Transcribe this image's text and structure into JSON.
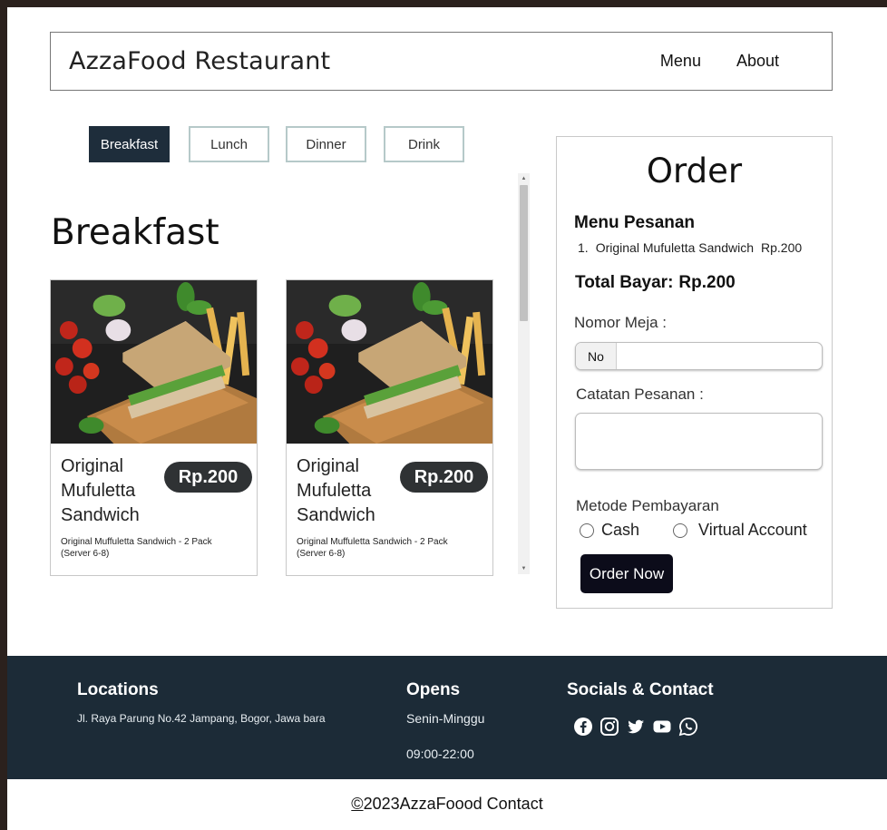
{
  "header": {
    "brand": "AzzaFood Restaurant",
    "nav": [
      "Menu",
      "About"
    ]
  },
  "categories": [
    {
      "label": "Breakfast",
      "active": true
    },
    {
      "label": "Lunch",
      "active": false
    },
    {
      "label": "Dinner",
      "active": false
    },
    {
      "label": "Drink",
      "active": false
    }
  ],
  "section_title": "Breakfast",
  "products": [
    {
      "name": "Original Mufuletta Sandwich",
      "price": "Rp.200",
      "description": "Original Muffuletta Sandwich - 2 Pack (Server 6-8)"
    },
    {
      "name": "Original Mufuletta Sandwich",
      "price": "Rp.200",
      "description": "Original Muffuletta Sandwich - 2 Pack (Server 6-8)"
    }
  ],
  "order": {
    "title": "Order",
    "menu_heading": "Menu Pesanan",
    "items": [
      {
        "index": "1.",
        "name": "Original Mufuletta Sandwich",
        "price": "Rp.200"
      }
    ],
    "total_label": "Total Bayar:",
    "total_value": "Rp.200",
    "table_label": "Nomor Meja :",
    "table_prefix": "No",
    "notes_label": "Catatan Pesanan :",
    "payment_label": "Metode Pembayaran",
    "payment_options": [
      "Cash",
      "Virtual Account"
    ],
    "submit_label": "Order Now"
  },
  "footer": {
    "locations_title": "Locations",
    "address": "Jl. Raya Parung No.42 Jampang, Bogor, Jawa bara",
    "opens_title": "Opens",
    "days": "Senin-Minggu",
    "hours": "09:00-22:00",
    "socials_title": "Socials & Contact",
    "social_icons": [
      "facebook-icon",
      "instagram-icon",
      "twitter-icon",
      "youtube-icon",
      "whatsapp-icon"
    ]
  },
  "copyright": {
    "symbol": "©",
    "text": "2023AzzaFoood Contact"
  },
  "colors": {
    "accent": "#1e2d3b",
    "footer_bg": "#1c2b37",
    "button_dark": "#0c0c1a",
    "price_badge": "#2f3234"
  }
}
